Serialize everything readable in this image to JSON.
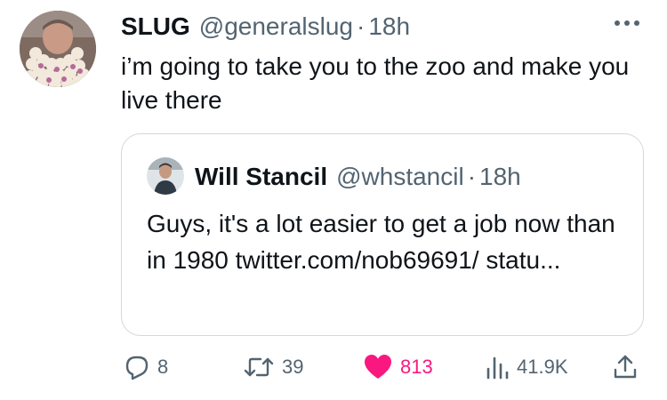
{
  "tweet": {
    "author_name": "SLUG",
    "author_handle": "@generalslug",
    "separator": "·",
    "time": "18h",
    "text": "i’m going to take you to the zoo and make you live there"
  },
  "quoted_tweet": {
    "author_name": "Will Stancil",
    "author_handle": "@whstancil",
    "separator": "·",
    "time": "18h",
    "text": "Guys, it's a lot easier to get a job now than in 1980 twitter.com/nob69691/ statu..."
  },
  "actions": {
    "replies": "8",
    "retweets": "39",
    "likes": "813",
    "views": "41.9K"
  },
  "icons": {
    "more": "more-horizontal-icon",
    "reply": "reply-bubble-icon",
    "retweet": "retweet-icon",
    "like": "heart-icon",
    "views": "bar-chart-icon",
    "share": "share-upload-icon"
  },
  "colors": {
    "text": "#0f1419",
    "secondary": "#536471",
    "like": "#f91880",
    "border": "#cfd9de"
  }
}
